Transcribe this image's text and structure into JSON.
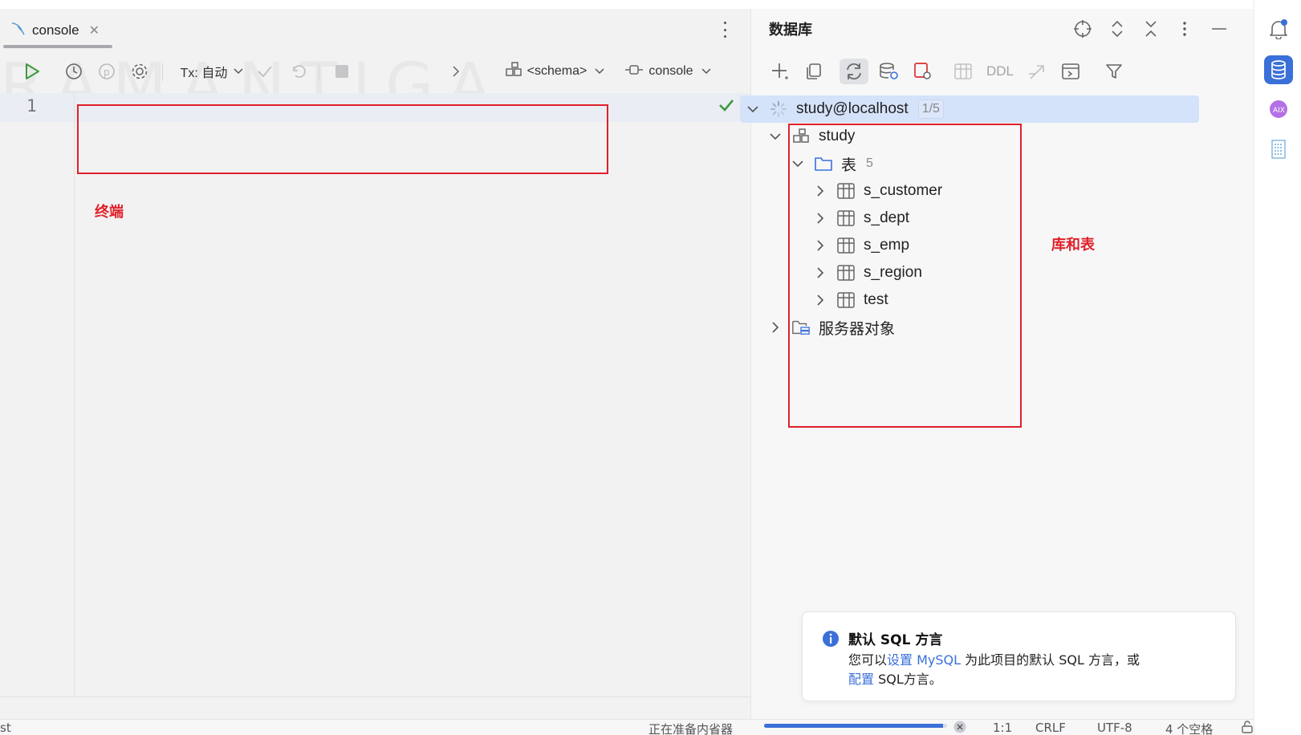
{
  "editor": {
    "tab_title": "console",
    "toolbar": {
      "tx_label": "Tx: 自动",
      "schema_label": "<schema>",
      "session_label": "console"
    },
    "line_number": "1",
    "annotation_terminal": "终端"
  },
  "db_panel": {
    "title": "数据库",
    "toolbar": {
      "ddl_label": "DDL"
    },
    "tree": {
      "datasource": {
        "label": "study@localhost",
        "count": "1/5"
      },
      "schema": {
        "label": "study"
      },
      "tables_folder": {
        "label": "表",
        "count": "5"
      },
      "tables": [
        "s_customer",
        "s_dept",
        "s_emp",
        "s_region",
        "test"
      ],
      "server_objects": {
        "label": "服务器对象"
      }
    },
    "annotation_db_tables": "库和表"
  },
  "notification": {
    "title": "默认 SQL 方言",
    "body_part1": "您可以",
    "link_set": "设置 MySQL",
    "body_part2": " 为此项目的默认 SQL 方言，或",
    "link_config": "配置",
    "body_part3": " SQL方言。"
  },
  "status_bar": {
    "left_text": "st",
    "indexing_text": "正在准备内省器",
    "position": "1:1",
    "line_ending": "CRLF",
    "encoding": "UTF-8",
    "indent": "4 个空格",
    "progress_fraction": 0.98
  },
  "colors": {
    "accent": "#3a70d8",
    "annotation_red": "#e0202a",
    "success_green": "#3c9a3c",
    "selected_row": "#d4e2fa"
  }
}
